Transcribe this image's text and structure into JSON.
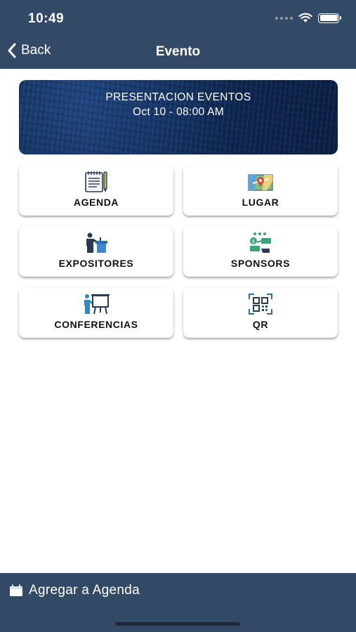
{
  "status_bar": {
    "time": "10:49"
  },
  "nav": {
    "back_label": "Back",
    "title": "Evento"
  },
  "event": {
    "name": "PRESENTACION EVENTOS",
    "datetime": "Oct 10 - 08:00 AM"
  },
  "menu": [
    {
      "label": "AGENDA",
      "icon": "notepad-icon"
    },
    {
      "label": "LUGAR",
      "icon": "map-pin-icon"
    },
    {
      "label": "EXPOSITORES",
      "icon": "speaker-podium-icon"
    },
    {
      "label": "SPONSORS",
      "icon": "money-exchange-icon"
    },
    {
      "label": "CONFERENCIAS",
      "icon": "presentation-board-icon"
    },
    {
      "label": "QR",
      "icon": "qr-code-icon"
    }
  ],
  "footer": {
    "add_label": "Agregar a Agenda"
  },
  "colors": {
    "bar": "#334a66",
    "banner": "#0f2c5a"
  }
}
